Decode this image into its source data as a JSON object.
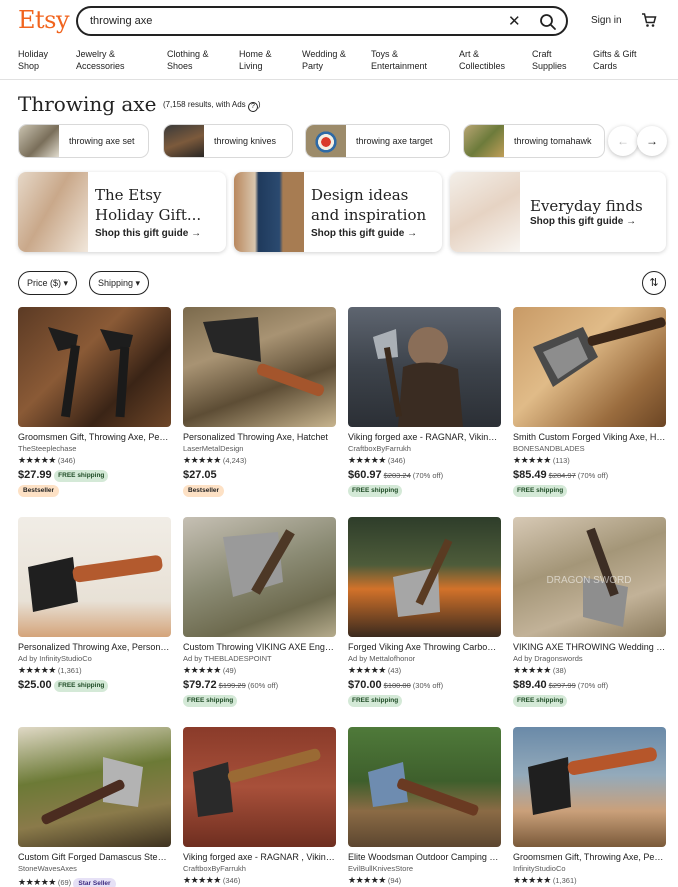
{
  "header": {
    "logo": "Etsy",
    "search_value": "throwing axe",
    "sign_in": "Sign in"
  },
  "categories": [
    {
      "line1": "Holiday",
      "line2": "Shop"
    },
    {
      "line1": "Jewelry &",
      "line2": "Accessories"
    },
    {
      "line1": "Clothing &",
      "line2": "Shoes"
    },
    {
      "line1": "Home &",
      "line2": "Living"
    },
    {
      "line1": "Wedding &",
      "line2": "Party"
    },
    {
      "line1": "Toys &",
      "line2": "Entertainment"
    },
    {
      "line1": "Art &",
      "line2": "Collectibles"
    },
    {
      "line1": "Craft",
      "line2": "Supplies"
    },
    {
      "line1": "Gifts & Gift",
      "line2": "Cards"
    }
  ],
  "page": {
    "title": "Throwing axe",
    "results": "(7,158 results, with Ads",
    "results_end": ")",
    "info_icon": "?"
  },
  "related": [
    {
      "label": "throwing axe set"
    },
    {
      "label": "throwing knives"
    },
    {
      "label": "throwing axe target"
    },
    {
      "label": "throwing tomahawk"
    }
  ],
  "carousel": {
    "prev": "←",
    "next": "→"
  },
  "guides": [
    {
      "title1": "The Etsy",
      "title2": "Holiday Gift...",
      "link": "Shop this gift guide →"
    },
    {
      "title1": "Design ideas",
      "title2": "and inspiration",
      "link": "Shop this gift guide →"
    },
    {
      "title1": "Everyday finds",
      "title2": "",
      "link": "Shop this gift guide →"
    }
  ],
  "filters": {
    "price": "Price ($) ▾",
    "shipping": "Shipping ▾",
    "sort_icon": "⇅"
  },
  "listings": [
    {
      "title": "Groomsmen Gift, Throwing Axe, Personalized",
      "shop": "TheSteeplechase",
      "stars": "★★★★★",
      "count": "(346)",
      "price": "$27.99",
      "orig": "",
      "discount": "",
      "free": "FREE shipping",
      "free_inline": true,
      "badge": "Bestseller",
      "badge_type": "best"
    },
    {
      "title": "Personalized Throwing Axe, Hatchet",
      "shop": "LaserMetalDesign",
      "stars": "★★★★★",
      "count": "(4,243)",
      "price": "$27.05",
      "orig": "",
      "discount": "",
      "free": "",
      "free_inline": true,
      "badge": "Bestseller",
      "badge_type": "best"
    },
    {
      "title": "Viking forged axe - RAGNAR, Viking axe",
      "shop": "CraftboxByFarrukh",
      "stars": "★★★★★",
      "count": "(346)",
      "price": "$60.97",
      "orig": "$203.24",
      "discount": "(70% off)",
      "free": "FREE shipping",
      "free_inline": false,
      "badge": "",
      "badge_type": ""
    },
    {
      "title": "Smith Custom Forged Viking Axe, Handmade",
      "shop": "BONESANDBLADES",
      "stars": "★★★★★",
      "count": "(113)",
      "price": "$85.49",
      "orig": "$284.97",
      "discount": "(70% off)",
      "free": "FREE shipping",
      "free_inline": false,
      "badge": "",
      "badge_type": ""
    },
    {
      "title": "Personalized Throwing Axe, Personalized Gift",
      "shop": "Ad by InfinityStudioCo",
      "stars": "★★★★★",
      "count": "(1,361)",
      "price": "$25.00",
      "orig": "",
      "discount": "",
      "free": "FREE shipping",
      "free_inline": true,
      "badge": "",
      "badge_type": ""
    },
    {
      "title": "Custom Throwing VIKING AXE Engraved",
      "shop": "Ad by THEBLADESPOINT",
      "stars": "★★★★★",
      "count": "(49)",
      "price": "$79.72",
      "orig": "$199.29",
      "discount": "(60% off)",
      "free": "FREE shipping",
      "free_inline": false,
      "badge": "",
      "badge_type": ""
    },
    {
      "title": "Forged Viking Axe Throwing Carbon Steel",
      "shop": "Ad by Mettalofhonor",
      "stars": "★★★★★",
      "count": "(43)",
      "price": "$70.00",
      "orig": "$100.00",
      "discount": "(30% off)",
      "free": "FREE shipping",
      "free_inline": false,
      "badge": "",
      "badge_type": ""
    },
    {
      "title": "VIKING AXE THROWING Wedding Gift",
      "shop": "Ad by Dragonswords",
      "stars": "★★★★★",
      "count": "(38)",
      "price": "$89.40",
      "orig": "$297.99",
      "discount": "(70% off)",
      "free": "FREE shipping",
      "free_inline": false,
      "badge": "",
      "badge_type": ""
    },
    {
      "title": "Custom Gift Forged Damascus Steel Axe",
      "shop": "StoneWavesAxes",
      "stars": "★★★★★",
      "count": "(69)",
      "price": "",
      "orig": "",
      "discount": "",
      "free": "",
      "free_inline": true,
      "badge": "Star Seller",
      "badge_type": "star"
    },
    {
      "title": "Viking forged axe - RAGNAR , Viking axe",
      "shop": "CraftboxByFarrukh",
      "stars": "★★★★★",
      "count": "(346)",
      "price": "",
      "orig": "",
      "discount": "",
      "free": "",
      "free_inline": true,
      "badge": "",
      "badge_type": ""
    },
    {
      "title": "Elite Woodsman Outdoor Camping Hatchet",
      "shop": "EvilBullKnivesStore",
      "stars": "★★★★★",
      "count": "(94)",
      "price": "",
      "orig": "",
      "discount": "",
      "free": "",
      "free_inline": true,
      "badge": "",
      "badge_type": ""
    },
    {
      "title": "Groomsmen Gift, Throwing Axe, Personalized",
      "shop": "InfinityStudioCo",
      "stars": "★★★★★",
      "count": "(1,361)",
      "price": "",
      "orig": "",
      "discount": "",
      "free": "",
      "free_inline": true,
      "badge": "",
      "badge_type": ""
    }
  ],
  "colors": {
    "brand": "#f1641e",
    "free_bg": "#d4e9d7",
    "bestseller_bg": "#fde1c5",
    "star_seller_bg": "#e6e1f6"
  }
}
